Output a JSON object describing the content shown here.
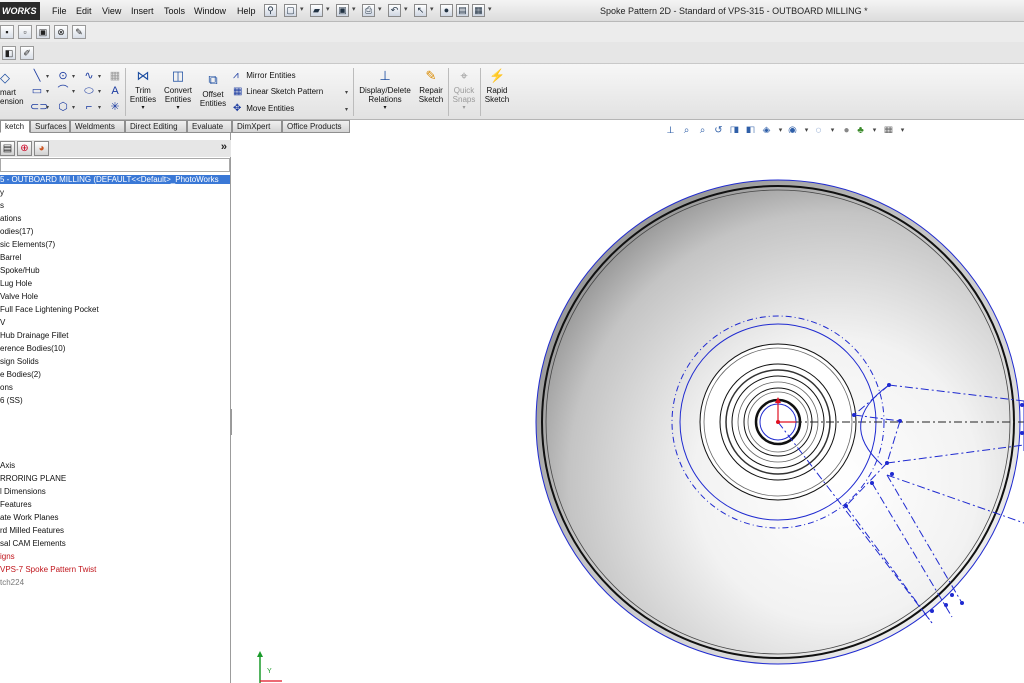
{
  "app": {
    "logo_text": "WORKS",
    "document_title": "Spoke Pattern 2D - Standard of VPS-315 - OUTBOARD MILLING *"
  },
  "menu": [
    "File",
    "Edit",
    "View",
    "Insert",
    "Tools",
    "Window",
    "Help"
  ],
  "command_manager": {
    "smart_dimension": "mart\nension",
    "trim": "Trim\nEntities",
    "convert": "Convert\nEntities",
    "offset": "Offset\nEntities",
    "mirror": "Mirror Entities",
    "linear_pattern": "Linear Sketch Pattern",
    "move": "Move Entities",
    "display_delete": "Display/Delete\nRelations",
    "repair": "Repair\nSketch",
    "quick_snaps": "Quick\nSnaps",
    "rapid_sketch": "Rapid\nSketch"
  },
  "tabs": [
    "ketch",
    "Surfaces",
    "Weldments",
    "Direct Editing",
    "Evaluate",
    "DimXpert",
    "Office Products"
  ],
  "tree": {
    "root": "5 - OUTBOARD MILLING  (DEFAULT<<Default>_PhotoWorks",
    "items": [
      "y",
      "s",
      "ations",
      "odies(17)",
      "sic Elements(7)",
      "Barrel",
      "Spoke/Hub",
      "Lug Hole",
      "Valve Hole",
      "Full Face Lightening Pocket",
      "V",
      "Hub Drainage Fillet",
      "erence Bodies(10)",
      "sign Solids",
      "e Bodies(2)",
      "ons",
      "6 (SS)"
    ],
    "items2": [
      "Axis",
      "RRORING PLANE",
      "l Dimensions",
      "Features",
      "ate Work Planes",
      "rd Milled Features",
      "sal CAM Elements"
    ],
    "red_items": [
      "igns",
      "VPS-7 Spoke Pattern Twist"
    ],
    "grey_item": "tch224"
  },
  "colors": {
    "sketch_blue": "#1f2ad0",
    "selection": "#3a78d6",
    "origin_red": "#e01020",
    "axis_green": "#1a9a2a"
  }
}
